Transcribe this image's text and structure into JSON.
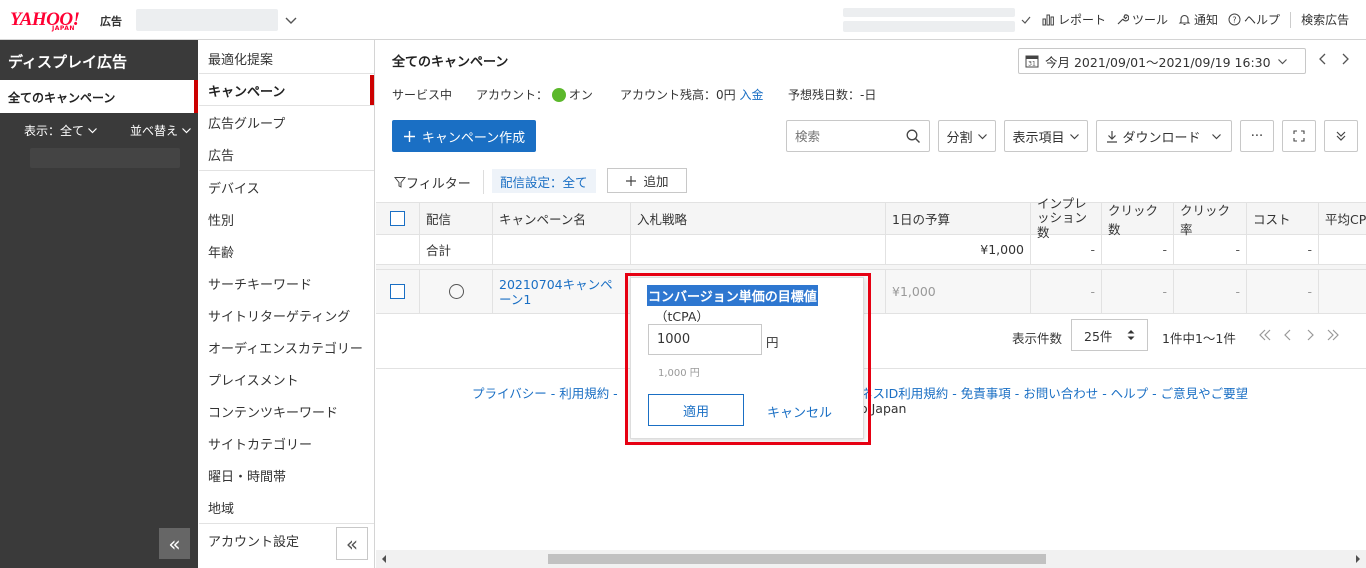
{
  "header": {
    "logo": "YAHOO!",
    "logo_sub": "JAPAN",
    "logo_ad": "広告",
    "links": [
      "レポート",
      "ツール",
      "通知",
      "ヘルプ",
      "検索広告"
    ]
  },
  "sidebar": {
    "title": "ディスプレイ広告",
    "active_item": "全てのキャンペーン",
    "display_label": "表示：全て",
    "sort_label": "並べ替え",
    "collapse_icon": "«"
  },
  "nav": {
    "items": [
      "最適化提案",
      "キャンペーン",
      "広告グループ",
      "広告",
      "デバイス",
      "性別",
      "年齢",
      "サーチキーワード",
      "サイトリターゲティング",
      "オーディエンスカテゴリー",
      "プレイスメント",
      "コンテンツキーワード",
      "サイトカテゴリー",
      "曜日・時間帯",
      "地域",
      "アカウント設定"
    ],
    "collapse_icon": "«"
  },
  "main": {
    "title": "全てのキャンペーン",
    "date_range": "今月 2021/09/01〜2021/09/19 16:30",
    "status": {
      "service": "サービス中",
      "account_label": "アカウント：",
      "account_state": "オン",
      "balance": "アカウント残高：0円",
      "deposit_link": "入金",
      "days_left": "予想残日数：-日"
    },
    "toolbar": {
      "create": "キャンペーン作成",
      "search_placeholder": "検索",
      "split": "分割",
      "display_items": "表示項目",
      "download": "ダウンロード",
      "more": "···"
    },
    "filter": {
      "label": "フィルター",
      "chip": "配信設定：全て",
      "add": "追加"
    },
    "table": {
      "headers": [
        "配信",
        "キャンペーン名",
        "入札戦略",
        "1日の予算",
        "インプレッション数",
        "クリック数",
        "クリック率",
        "コスト",
        "平均CPC"
      ],
      "total_label": "合計",
      "total_budget": "¥1,000",
      "total_dash": "-",
      "row": {
        "name": "20210704キャンペーン1",
        "budget": "¥1,000",
        "dash": "-"
      }
    },
    "pager": {
      "per_page_label": "表示件数",
      "per_page": "25件",
      "range": "1件中1〜1件"
    },
    "footer": {
      "links": "プライバシー - 利用規約 -",
      "links_right": "ネスID利用規約 - 免責事項 - お問い合わせ - ヘルプ - ご意見やご要望",
      "copy": "o Japan"
    }
  },
  "popup": {
    "title": "コンバージョン単価の目標値",
    "subtitle": "（tCPA）",
    "value": "1000",
    "unit": "円",
    "hint": "1,000 円",
    "apply": "適用",
    "cancel": "キャンセル"
  },
  "colors": {
    "brand_red": "#ff0033",
    "link_blue": "#1a6fc4",
    "active_bar": "#cc0000",
    "status_green": "#5bb82b",
    "highlight_outline": "#e60012"
  }
}
